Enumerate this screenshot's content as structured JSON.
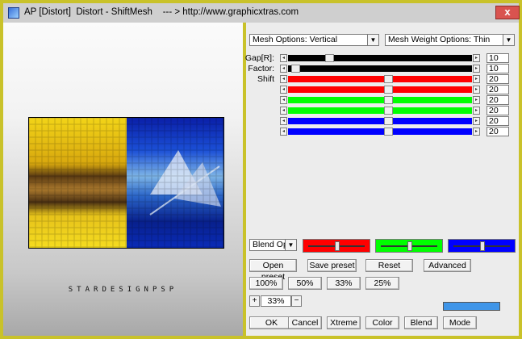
{
  "window": {
    "title": "AP [Distort]  Distort - ShiftMesh    --- > http://www.graphicxtras.com",
    "close_label": "x"
  },
  "watermark": "STARDESIGNPSP",
  "options": {
    "mesh_options": "Mesh Options: Vertical",
    "mesh_weight": "Mesh Weight Options: Thin",
    "blend_options": "Blend Optio"
  },
  "sliders": [
    {
      "label": "Gap[R]:",
      "value": "10",
      "color": "#000000",
      "position": 0.21
    },
    {
      "label": "Factor:",
      "value": "10",
      "color": "#000000",
      "position": 0.02
    },
    {
      "label": "Shift",
      "value": "20",
      "color": "#ff0000",
      "position": 0.55
    },
    {
      "label": "",
      "value": "20",
      "color": "#ff0000",
      "position": 0.55
    },
    {
      "label": "",
      "value": "20",
      "color": "#00ff00",
      "position": 0.55
    },
    {
      "label": "",
      "value": "20",
      "color": "#00ff00",
      "position": 0.55
    },
    {
      "label": "",
      "value": "20",
      "color": "#0000ff",
      "position": 0.55
    },
    {
      "label": "",
      "value": "20",
      "color": "#0000ff",
      "position": 0.55
    }
  ],
  "color_sliders": [
    {
      "color": "#ff0000",
      "position": 0.5
    },
    {
      "color": "#00ff00",
      "position": 0.5
    },
    {
      "color": "#0000ff",
      "position": 0.5
    }
  ],
  "buttons": {
    "open_preset": "Open preset",
    "save_preset": "Save preset",
    "reset": "Reset",
    "advanced": "Advanced",
    "zoom_100": "100%",
    "zoom_50": "50%",
    "zoom_33": "33%",
    "zoom_25": "25%",
    "ok": "OK",
    "cancel": "Cancel",
    "xtreme": "Xtreme",
    "color": "Color",
    "blend": "Blend",
    "mode": "Mode"
  },
  "zoom": {
    "plus": "+",
    "minus": "−",
    "value": "33%"
  },
  "accent_color": "#3f95e8"
}
